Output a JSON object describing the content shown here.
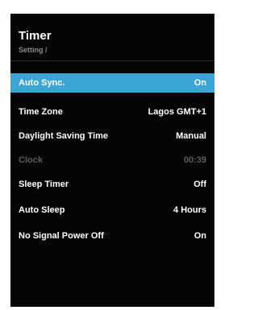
{
  "header": {
    "title": "Timer",
    "breadcrumb": "Setting /"
  },
  "menu": {
    "items": [
      {
        "label": "Auto Sync.",
        "value": "On",
        "state": "selected"
      },
      {
        "label": "Time Zone",
        "value": "Lagos GMT+1",
        "state": "normal"
      },
      {
        "label": "Daylight Saving Time",
        "value": "Manual",
        "state": "normal"
      },
      {
        "label": "Clock",
        "value": "00:39",
        "state": "disabled"
      },
      {
        "label": "Sleep Timer",
        "value": "Off",
        "state": "normal"
      },
      {
        "label": "Auto Sleep",
        "value": "4 Hours",
        "state": "normal"
      },
      {
        "label": "No Signal Power Off",
        "value": "On",
        "state": "normal"
      }
    ]
  },
  "colors": {
    "panel_bg": "#050505",
    "highlight": "#3ba6d6",
    "disabled_text": "#5d5d5d"
  }
}
